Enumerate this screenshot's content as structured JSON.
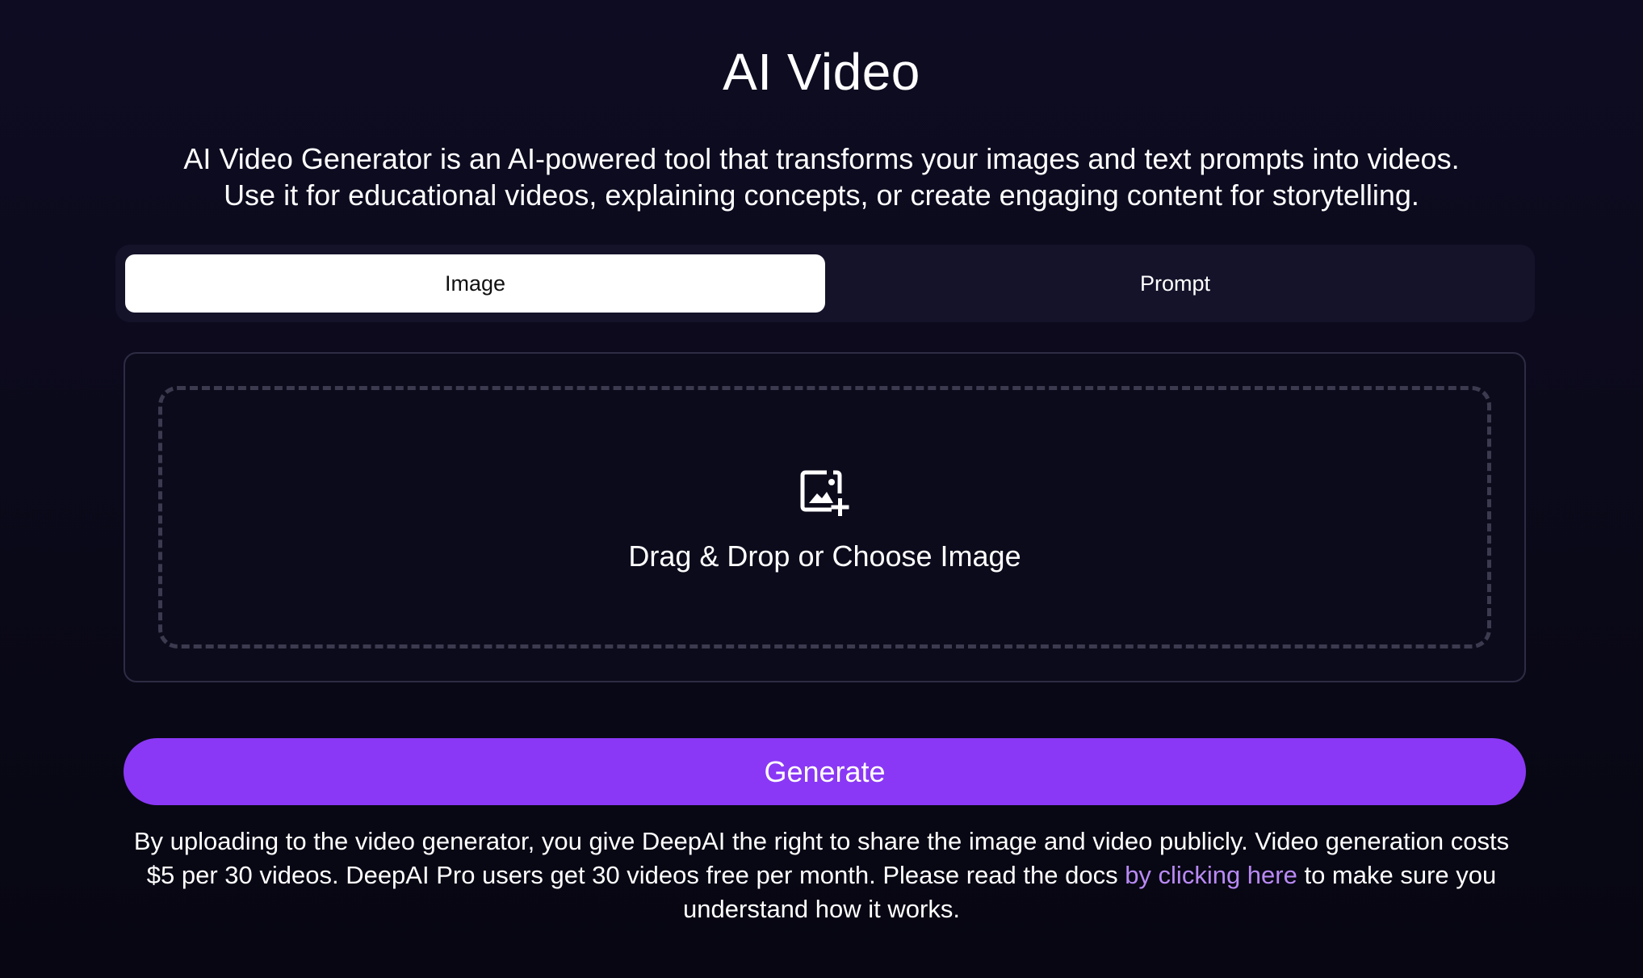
{
  "header": {
    "title": "AI Video",
    "subtitle_line1": "AI Video Generator is an AI-powered tool that transforms your images and text prompts into videos.",
    "subtitle_line2": "Use it for educational videos, explaining concepts, or create engaging content for storytelling."
  },
  "tabs": [
    {
      "label": "Image",
      "active": true
    },
    {
      "label": "Prompt",
      "active": false
    }
  ],
  "upload": {
    "icon": "image-add-icon",
    "label": "Drag & Drop or Choose Image"
  },
  "generate": {
    "label": "Generate"
  },
  "disclaimer": {
    "text_before_link": "By uploading to the video generator, you give DeepAI the right to share the image and video publicly. Video generation costs $5 per 30 videos. DeepAI Pro users get 30 videos free per month. Please read the docs ",
    "link_text": "by clicking here",
    "text_after_link": " to make sure you understand how it works."
  },
  "colors": {
    "background": "#0b0a1a",
    "accent": "#8a38f5",
    "link": "#b98af5",
    "tab_active_bg": "#ffffff"
  }
}
